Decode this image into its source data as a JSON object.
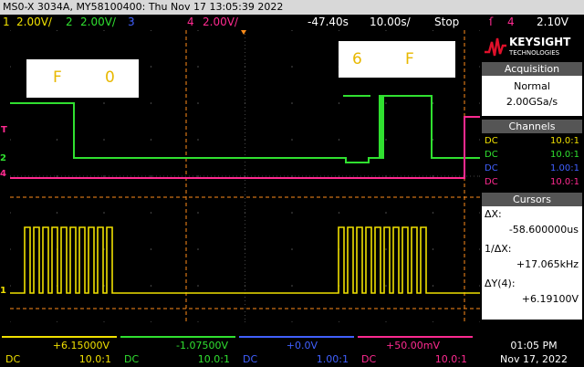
{
  "title": "MS0-X 3034A, MY58100400: Thu Nov 17 13:05:39 2022",
  "channels_bar": {
    "ch1_num": "1",
    "ch1_scale": "2.00V/",
    "ch2_num": "2",
    "ch2_scale": "2.00V/",
    "ch3_num": "3",
    "ch4_num": "4",
    "ch4_scale": "2.00V/",
    "time_offset": "-47.40s",
    "time_scale": "10.00s/",
    "run_state": "Stop",
    "trigger_level": "2.10V"
  },
  "annotations": {
    "left_box": {
      "a": "F",
      "b": "0"
    },
    "right_box": {
      "a": "6",
      "b": "F"
    }
  },
  "brand": {
    "name": "KEYSIGHT",
    "sub": "TECHNOLOGIES"
  },
  "acquisition": {
    "header": "Acquisition",
    "mode": "Normal",
    "rate": "2.00GSa/s"
  },
  "channels_panel": {
    "header": "Channels",
    "rows": [
      {
        "coupling": "DC",
        "probe": "10.0:1",
        "color": "#f0e000"
      },
      {
        "coupling": "DC",
        "probe": "10.0:1",
        "color": "#30e030"
      },
      {
        "coupling": "DC",
        "probe": "1.00:1",
        "color": "#4060ff"
      },
      {
        "coupling": "DC",
        "probe": "10.0:1",
        "color": "#ff2a90"
      }
    ]
  },
  "cursors": {
    "header": "Cursors",
    "dx_label": "ΔX:",
    "dx_value": "-58.600000us",
    "inv_label": "1/ΔX:",
    "inv_value": "+17.065kHz",
    "dy_label": "ΔY(4):",
    "dy_value": "+6.19100V"
  },
  "bottom": [
    {
      "value": "+6.15000V",
      "coupling": "DC",
      "probe": "10.0:1",
      "color": "#f0e000"
    },
    {
      "value": "-1.07500V",
      "coupling": "DC",
      "probe": "10.0:1",
      "color": "#30e030"
    },
    {
      "value": "+0.0V",
      "coupling": "DC",
      "probe": "1.00:1",
      "color": "#4060ff"
    },
    {
      "value": "+50.00mV",
      "coupling": "DC",
      "probe": "10.0:1",
      "color": "#ff2a90"
    }
  ],
  "clock": {
    "time": "01:05 PM",
    "date": "Nov 17, 2022"
  },
  "colors": {
    "ch1": "#f0e000",
    "ch2": "#30e030",
    "ch3": "#4060ff",
    "ch4": "#ff2a90",
    "cursor": "#ff8c1a"
  }
}
